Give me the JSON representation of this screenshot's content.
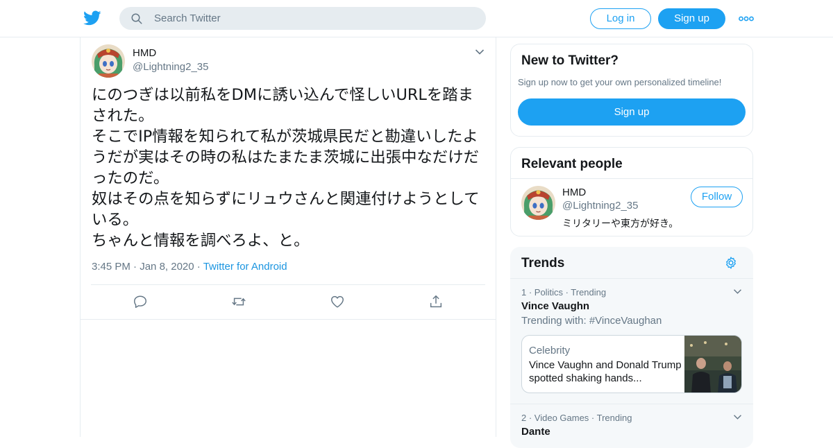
{
  "header": {
    "search_placeholder": "Search Twitter",
    "login_label": "Log in",
    "signup_label": "Sign up"
  },
  "tweet": {
    "name": "HMD",
    "handle": "@Lightning2_35",
    "text": "にのつぎは以前私をDMに誘い込んで怪しいURLを踏まされた。\nそこでIP情報を知られて私が茨城県民だと勘違いしたようだが実はその時の私はたまたま茨城に出張中なだけだったのだ。\n奴はその点を知らずにリュウさんと関連付けようとしている。\nちゃんと情報を調べろよ、と。",
    "time": "3:45 PM",
    "date": "Jan 8, 2020",
    "separator": "·",
    "source": "Twitter for Android"
  },
  "new_to_twitter": {
    "title": "New to Twitter?",
    "subtitle": "Sign up now to get your own personalized timeline!",
    "button": "Sign up"
  },
  "relevant_people": {
    "title": "Relevant people",
    "person": {
      "name": "HMD",
      "handle": "@Lightning2_35",
      "bio": "ミリタリーや東方が好き。",
      "follow_label": "Follow"
    }
  },
  "trends": {
    "title": "Trends",
    "items": [
      {
        "meta": "1 · Politics · Trending",
        "name": "Vince Vaughn",
        "with": "Trending with: #VinceVaughan",
        "news": {
          "category": "Celebrity",
          "headline": "Vince Vaughn and Donald Trump spotted shaking hands..."
        }
      },
      {
        "meta": "2 · Video Games · Trending",
        "name": "Dante"
      }
    ]
  },
  "colors": {
    "brand": "#1da1f2",
    "link": "#1b95e0",
    "muted": "#657786",
    "border": "#e6ecf0"
  },
  "icons": [
    "twitter-bird-icon",
    "search-icon",
    "more-dots-icon",
    "chevron-down-icon",
    "reply-icon",
    "retweet-icon",
    "like-icon",
    "share-icon",
    "gear-icon"
  ]
}
